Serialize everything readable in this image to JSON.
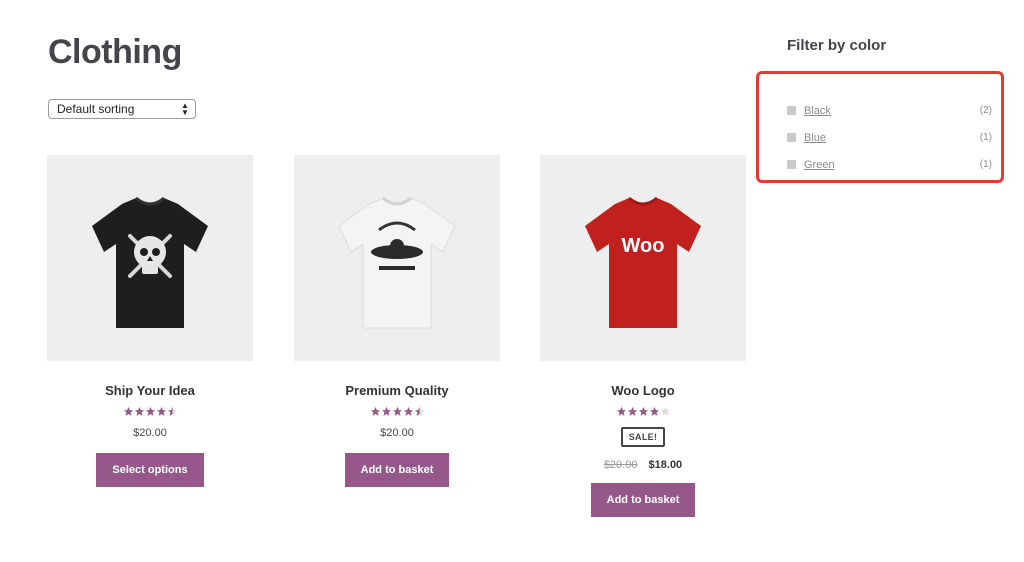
{
  "page": {
    "title": "Clothing"
  },
  "sorting": {
    "selected": "Default sorting"
  },
  "products": [
    {
      "title": "Ship Your Idea",
      "rating": 4.5,
      "price": "$20.00",
      "button": "Select options",
      "shirt_color": "#1e1e1e",
      "print": "skull-crossbones"
    },
    {
      "title": "Premium Quality",
      "rating": 4.5,
      "price": "$20.00",
      "button": "Add to basket",
      "shirt_color": "#f2f2f2",
      "print": "woothemes-logo"
    },
    {
      "title": "Woo Logo",
      "rating": 4,
      "sale_badge": "SALE!",
      "old_price": "$20.00",
      "price": "$18.00",
      "button": "Add to basket",
      "shirt_color": "#c0201e",
      "print": "woo-text",
      "print_text": "Woo"
    }
  ],
  "filter": {
    "title": "Filter by color",
    "items": [
      {
        "label": "Black",
        "count": "(2)"
      },
      {
        "label": "Blue",
        "count": "(1)"
      },
      {
        "label": "Green",
        "count": "(1)"
      }
    ]
  },
  "colors": {
    "accent": "#96588a",
    "star": "#96588a",
    "highlight": "#e8392f",
    "image_bg": "#eeeeee"
  }
}
